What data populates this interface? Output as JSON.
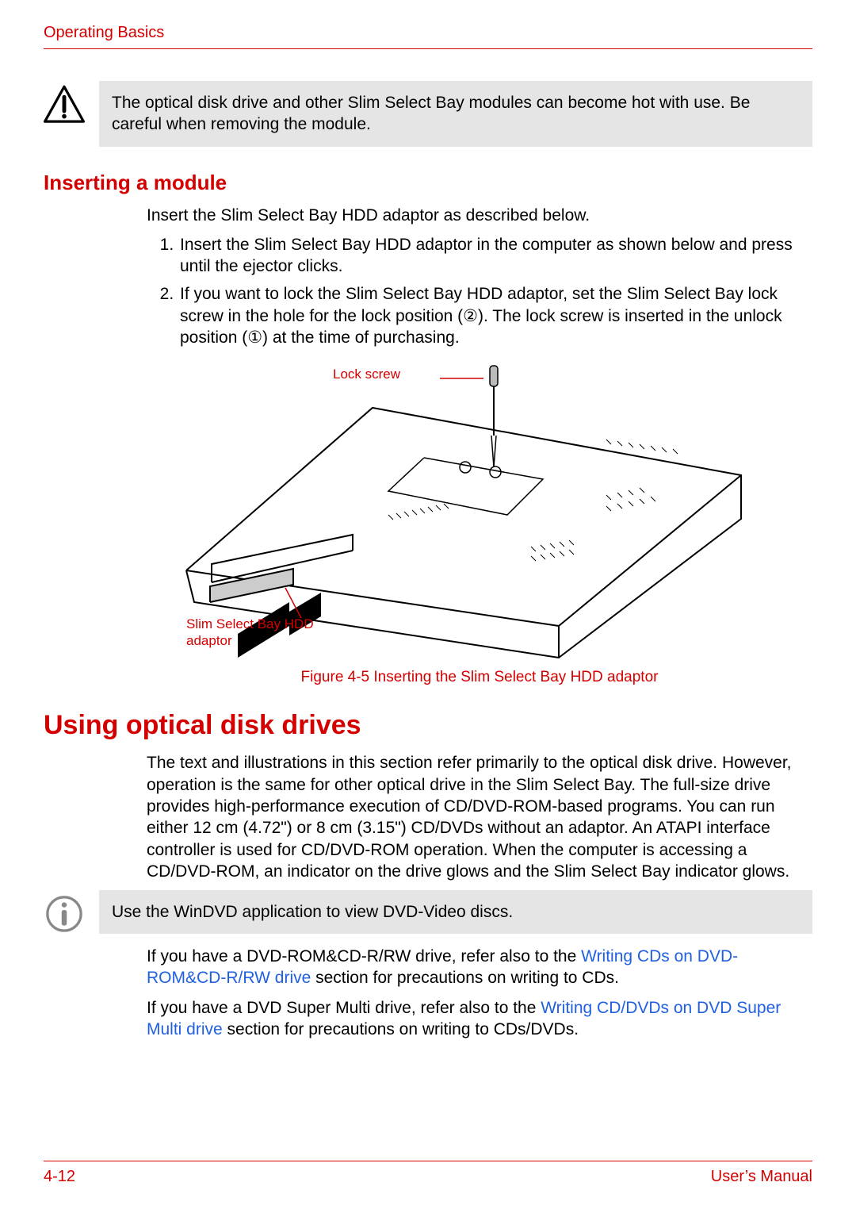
{
  "header": {
    "section": "Operating Basics"
  },
  "warning_box": {
    "text": "The optical disk drive and other Slim Select Bay modules can become hot with use. Be careful when removing the module."
  },
  "inserting": {
    "title": "Inserting a module",
    "intro": "Insert the Slim Select Bay HDD adaptor as described below.",
    "step1": "Insert the Slim Select Bay HDD adaptor in the computer as shown below and press until the ejector clicks.",
    "step2": "If you want to lock the Slim Select Bay HDD adaptor, set the Slim Select Bay lock screw in the hole for the lock position (②). The lock screw is inserted in the unlock position (①) at the time of purchasing."
  },
  "figure": {
    "label_lockscrew": "Lock screw",
    "label_adaptor_l1": "Slim Select Bay HDD",
    "label_adaptor_l2": "adaptor",
    "caption": "Figure 4-5 Inserting the Slim Select Bay HDD adaptor"
  },
  "optical": {
    "heading": "Using optical disk drives",
    "para1": "The text and illustrations in this section refer primarily to the optical disk drive. However, operation is the same for other optical drive in the Slim Select Bay. The full-size drive provides high-performance execution of CD/DVD-ROM-based programs. You can run either 12 cm (4.72\") or 8 cm (3.15\") CD/DVDs without an adaptor. An ATAPI interface controller is used for CD/DVD-ROM operation. When the computer is accessing a CD/DVD-ROM, an indicator on the drive glows and the Slim Select Bay indicator glows.",
    "info_box": "Use the WinDVD application to view DVD-Video discs.",
    "para2_a": "If you have a DVD-ROM&CD-R/RW drive, refer also to the ",
    "para2_link": "Writing CDs on DVD-ROM&CD-R/RW drive",
    "para2_b": " section for precautions on writing to CDs.",
    "para3_a": "If you have a DVD Super Multi drive, refer also to the ",
    "para3_link": "Writing CD/DVDs on DVD Super Multi drive",
    "para3_b": " section for precautions on writing to CDs/DVDs."
  },
  "footer": {
    "page": "4-12",
    "doc": "User’s Manual"
  }
}
